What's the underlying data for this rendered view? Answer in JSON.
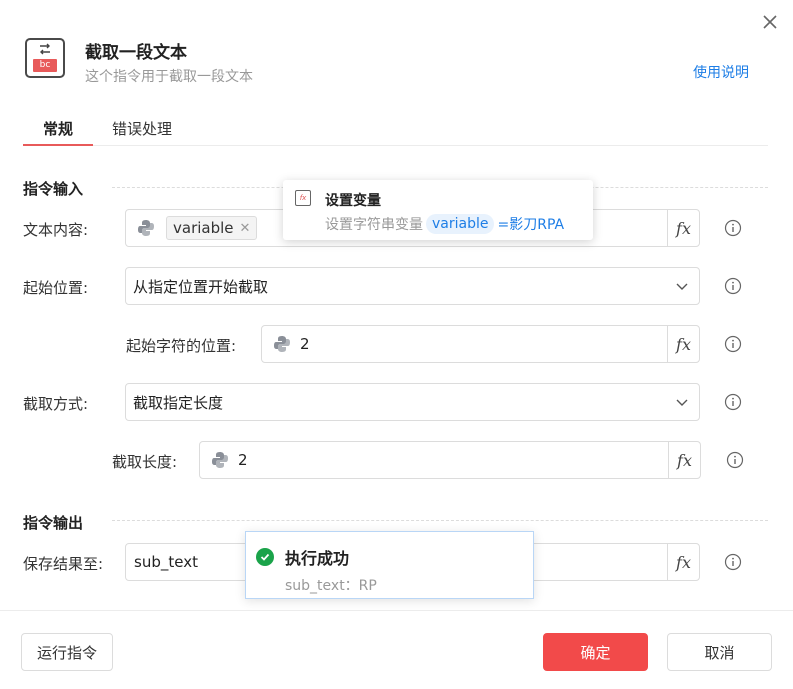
{
  "header": {
    "icon_top": "⇆",
    "icon_bottom": "bc",
    "title": "截取一段文本",
    "subtitle": "这个指令用于截取一段文本",
    "help_link": "使用说明"
  },
  "tabs": [
    {
      "label": "常规",
      "active": true
    },
    {
      "label": "错误处理",
      "active": false
    }
  ],
  "sections": {
    "input_title": "指令输入",
    "output_title": "指令输出"
  },
  "fields": {
    "text_content": {
      "label": "文本内容:",
      "tag": "variable"
    },
    "start_position": {
      "label": "起始位置:",
      "value": "从指定位置开始截取"
    },
    "start_char": {
      "label": "起始字符的位置:",
      "value": "2"
    },
    "cut_mode": {
      "label": "截取方式:",
      "value": "截取指定长度"
    },
    "cut_length": {
      "label": "截取长度:",
      "value": "2"
    },
    "save_to": {
      "label": "保存结果至:",
      "value": "sub_text"
    },
    "fx_label": "fx"
  },
  "popup": {
    "icon": "fx",
    "title": "设置变量",
    "desc_prefix": "设置字符串变量",
    "var_name": "variable",
    "assign": "=影刀RPA"
  },
  "toast": {
    "title": "执行成功",
    "detail": "sub_text：RP"
  },
  "footer": {
    "run_label": "运行指令",
    "confirm_label": "确定",
    "cancel_label": "取消"
  },
  "colors": {
    "accent": "#f24a4a",
    "link": "#1e7ee6",
    "success": "#1aa34a"
  }
}
